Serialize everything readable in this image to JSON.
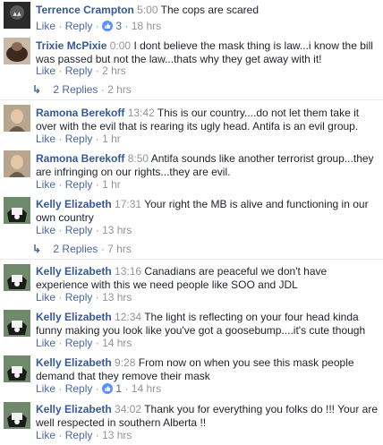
{
  "comments": [
    {
      "name": "Terrence Crampton",
      "time": "5:00",
      "text": "The cops are scared",
      "like": "Like",
      "reply": "Reply",
      "reactions": "3",
      "age": "18 hrs"
    },
    {
      "name": "Trixie McPixie",
      "time": "0:00",
      "text": "I dont believe the mask thing is law...i know the bill was passed but not the law...thats why they get away with it!",
      "like": "Like",
      "reply": "Reply",
      "age": "2 hrs",
      "replies_label": "2 Replies",
      "replies_age": "2 hrs"
    },
    {
      "name": "Ramona Berekoff",
      "time": "13:42",
      "text": "This is our country....do not let them take it over with the evil that is rearing its ugly head. Antifa is an evil group.",
      "like": "Like",
      "reply": "Reply",
      "age": "1 hr"
    },
    {
      "name": "Ramona Berekoff",
      "time": "8:50",
      "text": "Antifa sounds like another terrorist group...they are infringing on our rights...they are evil.",
      "like": "Like",
      "reply": "Reply",
      "age": "1 hr"
    },
    {
      "name": "Kelly Elizabeth",
      "time": "17:31",
      "text": "Your right the MB is alive and functioning in our own country",
      "like": "Like",
      "reply": "Reply",
      "age": "13 hrs",
      "replies_label": "2 Replies",
      "replies_age": "7 hrs"
    },
    {
      "name": "Kelly Elizabeth",
      "time": "13:16",
      "text": "Canadians are peaceful we don't have experience with this we need people like SOO and JDL",
      "like": "Like",
      "reply": "Reply",
      "age": "13 hrs"
    },
    {
      "name": "Kelly Elizabeth",
      "time": "12:34",
      "text": "The light is reflecting on your four head kinda funny making you look like you've got a goosebump....it's cute though",
      "like": "Like",
      "reply": "Reply",
      "age": "14 hrs"
    },
    {
      "name": "Kelly Elizabeth",
      "time": "9:28",
      "text": "From now on when you see this mask people demand that they remove their mask",
      "like": "Like",
      "reply": "Reply",
      "reactions": "1",
      "age": "14 hrs"
    },
    {
      "name": "Kelly Elizabeth",
      "time": "34:02",
      "text": "Thank you for everything you folks do !!! Your are well respected in southern Alberta !!",
      "like": "Like",
      "reply": "Reply",
      "age": "13 hrs"
    }
  ],
  "separator": "·",
  "colors": {
    "name": "#365899",
    "link": "#4b67a1",
    "meta": "#90949c",
    "text": "#1d2129"
  },
  "icons": [
    "like-reaction-icon",
    "reply-arrow-icon",
    "avatar-cow",
    "avatar-woman",
    "avatar-portrait"
  ]
}
